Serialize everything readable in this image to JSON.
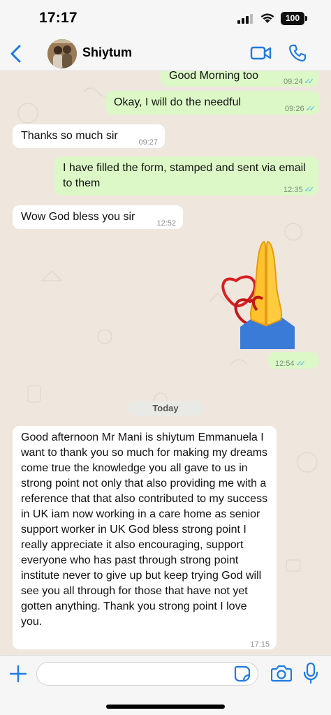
{
  "status_bar": {
    "time": "17:17",
    "battery": "100",
    "icons": [
      "signal-icon",
      "wifi-icon",
      "battery-icon"
    ]
  },
  "header": {
    "contact_name": "Shiytum",
    "accent_color": "#1f7ae0",
    "icons": [
      "chevron-left-icon",
      "video-camera-icon",
      "phone-icon"
    ]
  },
  "messages": [
    {
      "direction": "out",
      "text": "Good Morning too",
      "time": "09:24",
      "read": true
    },
    {
      "direction": "out",
      "text": "Okay, I will do the needful",
      "time": "09:26",
      "read": true
    },
    {
      "direction": "in",
      "text": "Thanks so much sir",
      "time": "09:27"
    },
    {
      "direction": "out",
      "text": "I have filled the form, stamped and sent via email to them",
      "time": "12:35",
      "read": true
    },
    {
      "direction": "in",
      "text": "Wow God bless you sir",
      "time": "12:52"
    },
    {
      "direction": "out",
      "sticker": "praying-hands-with-hearts",
      "time": "12:54",
      "read": true
    },
    {
      "date_separator": "Today"
    },
    {
      "direction": "in",
      "text": "Good afternoon Mr Mani is shiytum Emmanuela I want to thank you so much for making my dreams come true the knowledge you all  gave to us in strong point not only that also providing me with a reference that that also contributed to my success in UK iam now working in a  care home  as senior support worker in UK God bless strong point I really appreciate it also encouraging, support everyone who has past through strong point institute never to give up but keep trying God will see you all through for those that have not yet gotten anything. Thank you strong point I love you.",
      "time": "17:15"
    }
  ],
  "input_bar": {
    "value": "",
    "icons": [
      "plus-icon",
      "sticker-icon",
      "camera-icon",
      "microphone-icon"
    ]
  },
  "colors": {
    "outgoing_bubble": "#dcf8c6",
    "incoming_bubble": "#ffffff",
    "chat_background": "#efe7de",
    "read_ticks": "#4fb6ec"
  }
}
